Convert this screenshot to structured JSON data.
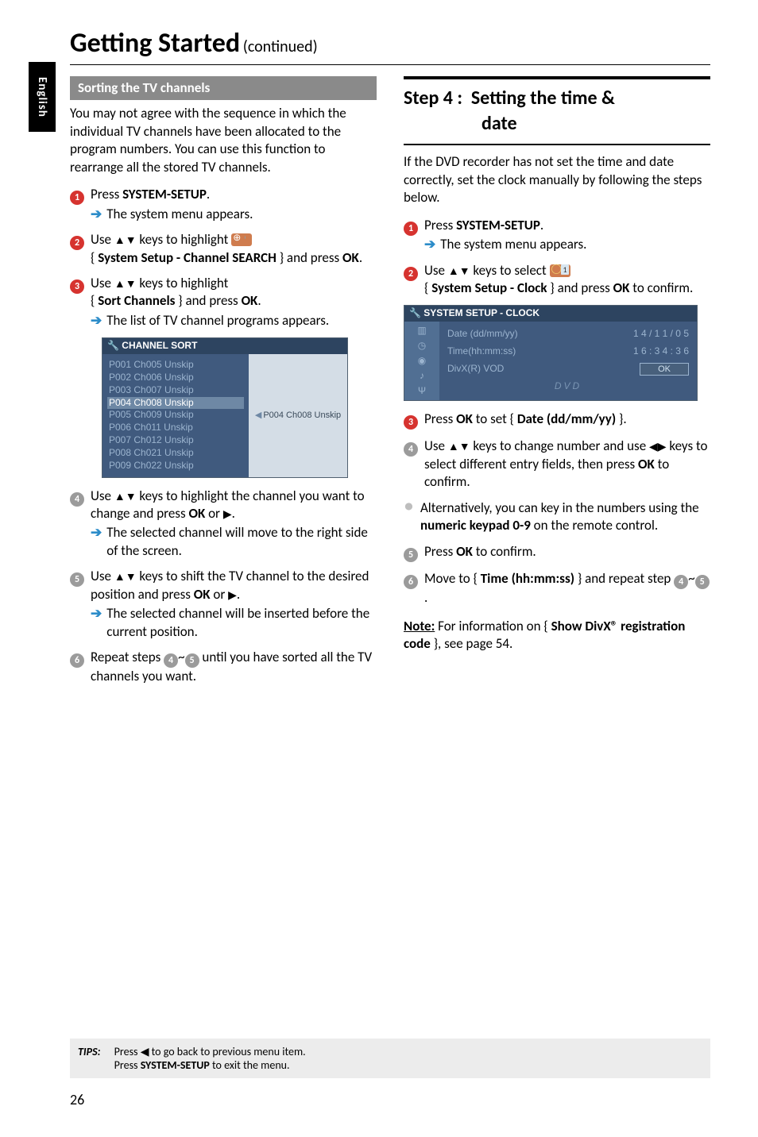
{
  "sidetab": "English",
  "title_main": "Getting Started",
  "title_sub": "(continued)",
  "left": {
    "subhead": "Sorting the TV channels",
    "intro": "You may not agree with the sequence in which the individual TV channels have been allocated to the program numbers. You can use this function to rearrange all the stored TV channels.",
    "s1_a": "Press ",
    "s1_b": "SYSTEM-SETUP",
    "s1_c": ".",
    "s1_sub": "The system menu appears.",
    "s2_a": "Use ",
    "s2_b": " keys to highlight ",
    "s2_c": "{ ",
    "s2_d": "System Setup - Channel SEARCH",
    "s2_e": " } and press ",
    "s2_f": "OK",
    "s2_g": ".",
    "s3_a": "Use ",
    "s3_b": " keys to highlight",
    "s3_c": "{ ",
    "s3_d": "Sort Channels",
    "s3_e": " } and press ",
    "s3_f": "OK",
    "s3_g": ".",
    "s3_sub": "The list of TV channel programs appears.",
    "osd": {
      "title": "CHANNEL SORT",
      "rows": [
        "P001 Ch005 Unskip",
        "P002 Ch006 Unskip",
        "P003 Ch007 Unskip",
        "P004 Ch008 Unskip",
        "P005 Ch009 Unskip",
        "P006 Ch011 Unskip",
        "P007 Ch012 Unskip",
        "P008 Ch021 Unskip",
        "P009 Ch022 Unskip"
      ],
      "side": "P004 Ch008 Unskip"
    },
    "s4_a": "Use ",
    "s4_b": " keys to highlight the channel you want to change and press ",
    "s4_c": "OK",
    "s4_d": " or ",
    "s4_e": ".",
    "s4_sub": "The selected channel will move to the right side of the screen.",
    "s5_a": "Use ",
    "s5_b": " keys to shift the TV channel to the desired position and press ",
    "s5_c": "OK",
    "s5_d": " or ",
    "s5_e": ".",
    "s5_sub": "The selected channel will be inserted before the current position.",
    "s6_a": "Repeat steps ",
    "s6_b": "~",
    "s6_c": " until you have sorted all the TV channels you want."
  },
  "right": {
    "step_title": "Step 4 :  Setting the time & date",
    "step_sub": "date",
    "intro": "If the DVD recorder has not set the time and date correctly, set the clock manually by following the steps below.",
    "s1_a": "Press ",
    "s1_b": "SYSTEM-SETUP",
    "s1_c": ".",
    "s1_sub": "The system menu appears.",
    "s2_a": "Use ",
    "s2_b": " keys to select ",
    "s2_c": "{ ",
    "s2_d": "System Setup - Clock",
    "s2_e": " } and press ",
    "s2_f": "OK",
    "s2_g": " to confirm.",
    "osd": {
      "title": "SYSTEM SETUP - CLOCK",
      "f1l": "Date (dd/mm/yy)",
      "f1r": "1 4 / 1 1 / 0 5",
      "f2l": "Time(hh:mm:ss)",
      "f2r": "1 6 : 3 4 : 3 6",
      "f3l": "DivX(R) VOD",
      "f3r": "OK",
      "dvd": "DVD"
    },
    "s3_a": "Press ",
    "s3_b": "OK",
    "s3_c": " to set { ",
    "s3_d": "Date (dd/mm/yy)",
    "s3_e": " }.",
    "s4_a": "Use ",
    "s4_b": " keys to change number and use ",
    "s4_c": " keys to select different entry fields, then press ",
    "s4_d": "OK",
    "s4_e": " to confirm.",
    "alt_a": "Alternatively, you can key in the numbers using the ",
    "alt_b": "numeric keypad 0-9",
    "alt_c": " on the remote control.",
    "s5_a": "Press ",
    "s5_b": "OK",
    "s5_c": " to confirm.",
    "s6_a": "Move to { ",
    "s6_b": "Time (hh:mm:ss)",
    "s6_c": " } and repeat step ",
    "s6_d": "~",
    "s6_e": ".",
    "note_a": "Note:",
    "note_b": " For information on { ",
    "note_c": "Show DivX® registration code",
    "note_d": " }, see page 54."
  },
  "tips": {
    "label": "TIPS:",
    "line1a": "Press ",
    "line1b": " to go back to previous menu item.",
    "line2a": "Press ",
    "line2b": "SYSTEM-SETUP",
    "line2c": " to exit the menu."
  },
  "pagenum": "26"
}
